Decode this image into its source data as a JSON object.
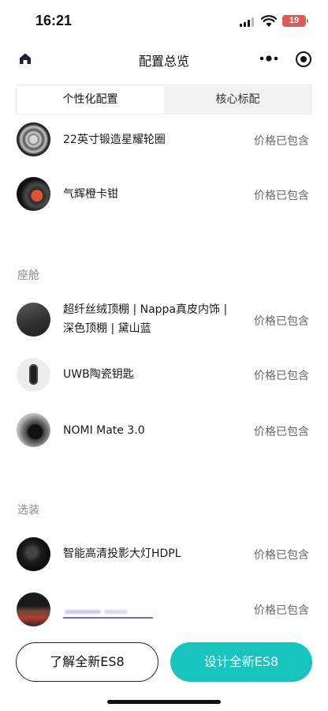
{
  "status_bar": {
    "time": "16:21",
    "battery": "19"
  },
  "nav": {
    "title": "配置总览"
  },
  "tabs": [
    {
      "label": "个性化配置",
      "active": true
    },
    {
      "label": "核心标配",
      "active": false
    }
  ],
  "sections": {
    "exterior": {
      "items": [
        {
          "name": "22英寸锻造星耀轮圈",
          "price": "价格已包含",
          "icon": "wheel-thumbnail"
        },
        {
          "name": "气辉橙卡钳",
          "price": "价格已包含",
          "icon": "caliper-thumbnail"
        }
      ]
    },
    "cabin": {
      "title": "座舱",
      "items": [
        {
          "name": "超纤丝绒顶棚 | Nappa真皮内饰 | 深色顶棚 | 黛山蓝",
          "price": "价格已包含",
          "icon": "interior-thumbnail"
        },
        {
          "name": "UWB陶瓷钥匙",
          "price": "价格已包含",
          "icon": "key-thumbnail"
        },
        {
          "name": "NOMI Mate 3.0",
          "price": "价格已包含",
          "icon": "nomi-thumbnail"
        }
      ]
    },
    "options": {
      "title": "选装",
      "items": [
        {
          "name": "智能高清投影大灯HDPL",
          "price": "价格已包含",
          "icon": "headlamp-thumbnail"
        },
        {
          "name": "",
          "price": "价格已包含",
          "icon": "screen-thumbnail"
        }
      ]
    }
  },
  "buttons": {
    "learn": "了解全新ES8",
    "design": "设计全新ES8"
  },
  "colors": {
    "accent": "#18c4bd",
    "battery": "#e05a55"
  }
}
